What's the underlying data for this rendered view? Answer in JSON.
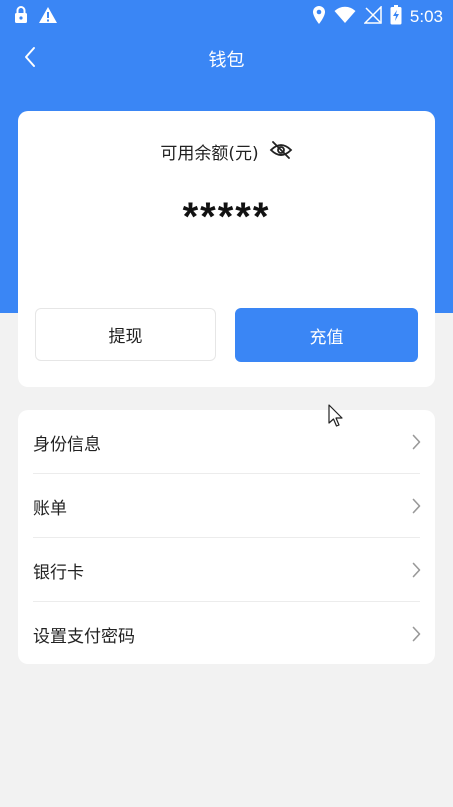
{
  "status_bar": {
    "time": "5:03",
    "icons": [
      "lock-icon",
      "warning-icon",
      "location-icon",
      "wifi-icon",
      "no-signal-icon",
      "battery-charging-icon"
    ]
  },
  "nav": {
    "title": "钱包",
    "back_icon": "chevron-left-icon"
  },
  "balance": {
    "label": "可用余额(元)",
    "value": "*****",
    "visibility_icon": "eye-off-icon"
  },
  "actions": {
    "withdraw_label": "提现",
    "recharge_label": "充值"
  },
  "menu": {
    "items": [
      {
        "label": "身份信息"
      },
      {
        "label": "账单"
      },
      {
        "label": "银行卡"
      },
      {
        "label": "设置支付密码"
      }
    ]
  },
  "colors": {
    "primary": "#3a86f5",
    "background": "#f2f2f2",
    "card": "#ffffff"
  }
}
